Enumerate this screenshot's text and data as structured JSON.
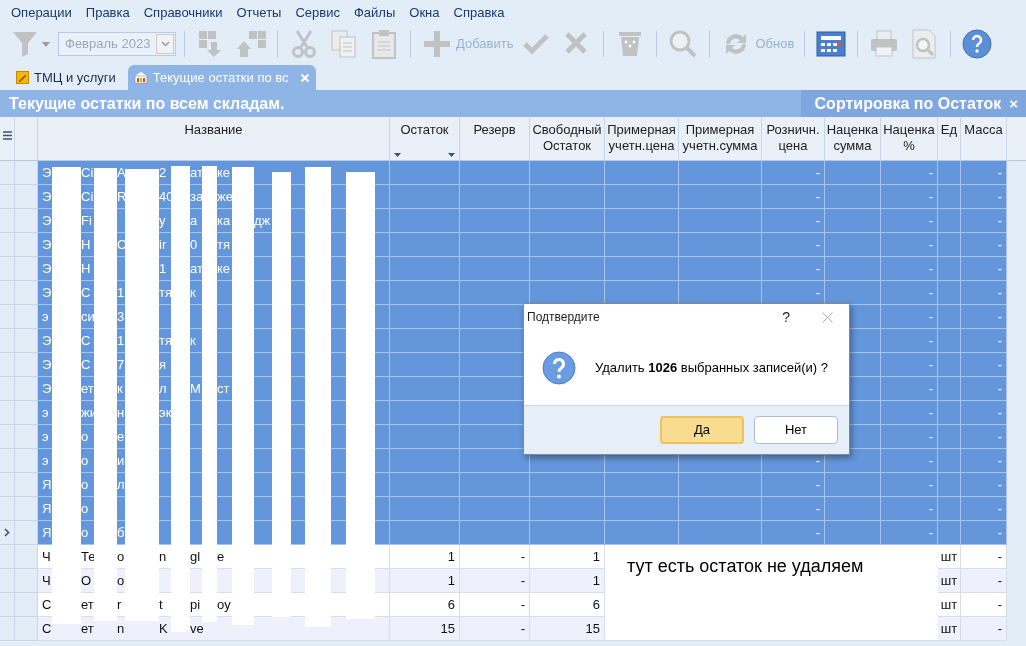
{
  "menu": [
    "Операции",
    "Правка",
    "Справочники",
    "Отчеты",
    "Сервис",
    "Файлы",
    "Окна",
    "Справка"
  ],
  "toolbar": [
    {
      "kind": "filter",
      "disabled": true
    },
    {
      "kind": "select",
      "value": "Февраль 2023",
      "disabled": true
    },
    {
      "kind": "sep"
    },
    {
      "kind": "move-down",
      "disabled": true
    },
    {
      "kind": "move-up",
      "disabled": true
    },
    {
      "kind": "sep"
    },
    {
      "kind": "cut",
      "disabled": true
    },
    {
      "kind": "copy",
      "disabled": true
    },
    {
      "kind": "paste",
      "disabled": true
    },
    {
      "kind": "sep"
    },
    {
      "kind": "add",
      "label": "Добавить",
      "disabled": true
    },
    {
      "kind": "check",
      "disabled": true
    },
    {
      "kind": "cancel",
      "disabled": true
    },
    {
      "kind": "sep"
    },
    {
      "kind": "delete",
      "disabled": true
    },
    {
      "kind": "sep"
    },
    {
      "kind": "search",
      "disabled": true
    },
    {
      "kind": "sep"
    },
    {
      "kind": "refresh",
      "label": "Обнов",
      "disabled": true
    },
    {
      "kind": "sep"
    },
    {
      "kind": "calculator",
      "disabled": false
    },
    {
      "kind": "sep"
    },
    {
      "kind": "print",
      "disabled": true
    },
    {
      "kind": "preview",
      "disabled": true
    },
    {
      "kind": "sep"
    },
    {
      "kind": "help",
      "disabled": false
    }
  ],
  "tabs": [
    {
      "label": "ТМЦ и услуги",
      "selected": false,
      "closable": false
    },
    {
      "label": "Текущие остатки по вс",
      "selected": true,
      "closable": true
    }
  ],
  "title": "Текущие остатки по всем складам.",
  "sort": {
    "label": "Сортировка по Остаток",
    "close": "×"
  },
  "columns": [
    "Название",
    "Остаток",
    "Резерв",
    "Свободный Остаток",
    "Примерная учетн.цена",
    "Примерная учетн.сумма",
    "Розничн. цена",
    "Наценка сумма",
    "Наценка %",
    "Ед",
    "Масса"
  ],
  "rows": [
    {
      "selected": true,
      "name": [
        "Э",
        "Ci",
        "A",
        "2",
        "ат",
        "ке"
      ],
      "retail": "-",
      "markup_pct": "-",
      "mass": "-"
    },
    {
      "selected": true,
      "name": [
        "Э",
        "Ci",
        "R",
        "40",
        "за",
        "же"
      ],
      "retail": "-",
      "markup_pct": "-",
      "mass": "-"
    },
    {
      "selected": true,
      "name": [
        "Э",
        "Fi",
        {
          "text": "у",
          "skip": true
        },
        "а",
        "ка",
        "дж"
      ],
      "retail": "-",
      "markup_pct": "-",
      "mass": "-"
    },
    {
      "selected": true,
      "name": [
        "Э",
        "H",
        "C",
        "ir",
        "0",
        "тя"
      ],
      "retail": "-",
      "markup_pct": "-",
      "mass": "-"
    },
    {
      "selected": true,
      "name": [
        "Э",
        "H",
        {
          "text": "1",
          "skip": true
        },
        "ат",
        "ке"
      ],
      "retail": "-",
      "markup_pct": "-",
      "mass": "-"
    },
    {
      "selected": true,
      "name": [
        "Э",
        "С",
        "1",
        "тя",
        "к"
      ],
      "retail": "-",
      "markup_pct": "-",
      "mass": "-"
    },
    {
      "selected": true,
      "name": [
        "э",
        "си",
        "3"
      ],
      "markup_pct": "-",
      "mass": "-"
    },
    {
      "selected": true,
      "name": [
        "Э",
        "С",
        "1",
        "тя",
        "к"
      ],
      "markup_pct": "-",
      "mass": "-"
    },
    {
      "selected": true,
      "name": [
        "Э",
        "С",
        "7",
        "я"
      ],
      "markup_pct": "-",
      "mass": "-"
    },
    {
      "selected": true,
      "name": [
        "Э",
        "ет",
        "к",
        "л",
        "М",
        "ст"
      ],
      "markup_pct": "-",
      "mass": "-"
    },
    {
      "selected": true,
      "name": [
        "э",
        "жи",
        "н",
        "эк"
      ],
      "markup_pct": "-",
      "mass": "-"
    },
    {
      "selected": true,
      "name": [
        "э",
        "о",
        "е"
      ],
      "markup_pct": "-",
      "mass": "-"
    },
    {
      "selected": true,
      "name": [
        "э",
        "о",
        "и"
      ],
      "retail": "-",
      "markup_pct": "-",
      "mass": "-"
    },
    {
      "selected": true,
      "name": [
        "Я",
        "о",
        "л"
      ],
      "retail": "-",
      "markup_pct": "-",
      "mass": "-"
    },
    {
      "selected": true,
      "name": [
        "Я",
        "о"
      ],
      "retail": "-",
      "markup_pct": "-",
      "mass": "-"
    },
    {
      "selected": true,
      "current": true,
      "name": [
        "Я",
        "о",
        "б"
      ],
      "retail": "-",
      "markup_pct": "-",
      "mass": "-"
    },
    {
      "selected": false,
      "name": [
        "Ч",
        "Те",
        "o",
        "n",
        "gl",
        "e"
      ],
      "stock": "1",
      "reserve": "-",
      "free": "1",
      "unit": "шт",
      "mass": "-"
    },
    {
      "selected": false,
      "name": [
        "Ч",
        "О",
        "о"
      ],
      "stock": "1",
      "reserve": "-",
      "free": "1",
      "unit": "шт",
      "mass": "-"
    },
    {
      "selected": false,
      "name": [
        "С",
        "ет",
        "r",
        "t",
        "pi",
        "oy"
      ],
      "stock": "6",
      "reserve": "-",
      "free": "6",
      "unit": "шт",
      "mass": "-"
    },
    {
      "selected": false,
      "name": [
        "С",
        "ет",
        "n",
        "K",
        "ve"
      ],
      "stock": "15",
      "reserve": "-",
      "free": "15",
      "unit": "шт",
      "mass": "-"
    }
  ],
  "note": "тут есть остаток не удаляем",
  "dialog": {
    "title": "Подтвердите",
    "help": "?",
    "message": "Удалить **1026** выбранных записей(и) ?",
    "buttons": [
      {
        "label": "Да",
        "default": true
      },
      {
        "label": "Нет",
        "default": false
      }
    ]
  }
}
